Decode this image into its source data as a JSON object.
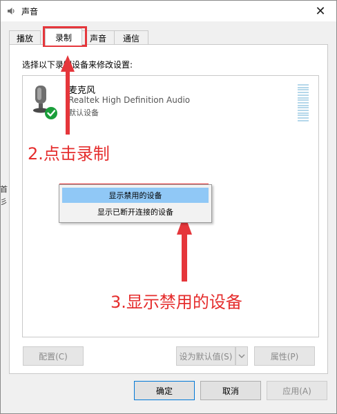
{
  "window": {
    "title": "声音",
    "close_glyph": "✕"
  },
  "tabs": [
    {
      "label": "播放"
    },
    {
      "label": "录制"
    },
    {
      "label": "声音"
    },
    {
      "label": "通信"
    }
  ],
  "panel": {
    "instruction": "选择以下录制设备来修改设置:"
  },
  "device": {
    "name": "麦克风",
    "driver": "Realtek High Definition Audio",
    "status": "默认设备"
  },
  "context_menu": {
    "items": [
      {
        "label": "显示禁用的设备"
      },
      {
        "label": "显示已断开连接的设备"
      }
    ]
  },
  "panel_buttons": {
    "configure": "配置(C)",
    "set_default": "设为默认值(S)",
    "properties": "属性(P)"
  },
  "dialog_buttons": {
    "ok": "确定",
    "cancel": "取消",
    "apply": "应用(A)"
  },
  "annotations": {
    "step2": "2.点击录制",
    "step3": "3.显示禁用的设备"
  },
  "edge_glyphs": [
    "首",
    "彡"
  ],
  "colors": {
    "annotation_red": "#e5363b",
    "menu_highlight": "#90c8f6",
    "default_check_green": "#1a9e3a",
    "primary_border": "#0078d7"
  }
}
